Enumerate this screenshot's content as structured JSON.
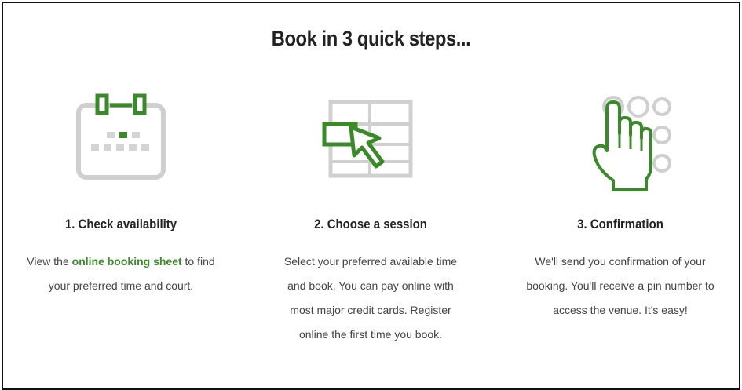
{
  "title": "Book in 3 quick steps...",
  "accent_color": "#3a8a2a",
  "steps": [
    {
      "icon": "calendar-icon",
      "heading": "1. Check availability",
      "text_before": "View the ",
      "link_text": "online booking sheet",
      "text_after": " to find your preferred time and court."
    },
    {
      "icon": "pointer-grid-icon",
      "heading": "2. Choose a session",
      "text": "Select your preferred available time and book. You can pay online with most major credit cards. Register online the first time you book."
    },
    {
      "icon": "touch-keypad-icon",
      "heading": "3. Confirmation",
      "text": "We'll send you confirmation of your booking. You'll receive a pin number to access the venue. It's easy!"
    }
  ]
}
